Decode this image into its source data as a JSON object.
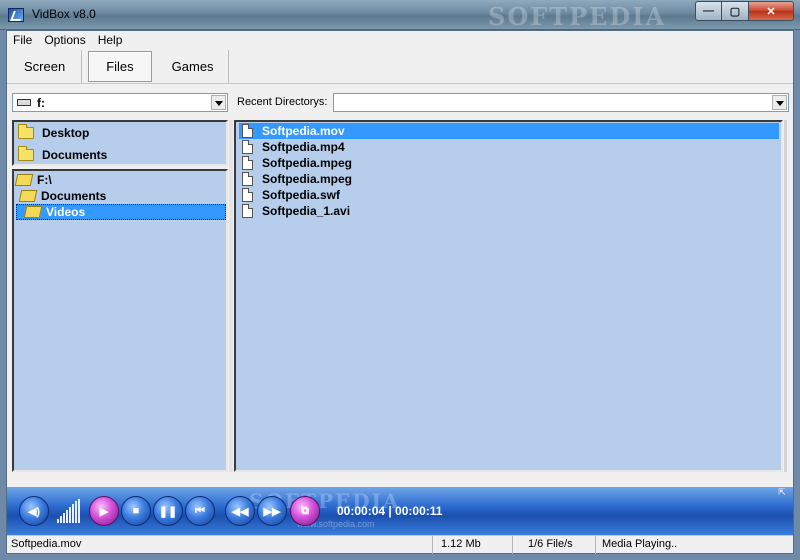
{
  "window": {
    "title": "VidBox v8.0",
    "watermark": "SOFTPEDIA",
    "controls": {
      "minimize": "—",
      "maximize": "▢",
      "close": "✕"
    }
  },
  "menu": [
    "File",
    "Options",
    "Help"
  ],
  "tabs": [
    {
      "label": "Screen",
      "active": false
    },
    {
      "label": "Files",
      "active": true
    },
    {
      "label": "Games",
      "active": false
    }
  ],
  "drive": {
    "selected": "f:"
  },
  "recent": {
    "label": "Recent Directorys:",
    "value": ""
  },
  "favorites": [
    "Desktop",
    "Documents"
  ],
  "tree": [
    {
      "label": "F:\\",
      "depth": 0
    },
    {
      "label": "Documents",
      "depth": 1
    },
    {
      "label": "Videos",
      "depth": 2,
      "selected": true
    }
  ],
  "files": [
    {
      "name": "Softpedia.mov",
      "selected": true
    },
    {
      "name": "Softpedia.mp4"
    },
    {
      "name": "Softpedia.mpeg"
    },
    {
      "name": "Softpedia.mpeg"
    },
    {
      "name": "Softpedia.swf"
    },
    {
      "name": "Softpedia_1.avi"
    }
  ],
  "player": {
    "time": "00:00:04 | 00:00:11",
    "watermark": "SOFTPEDIA",
    "watermark_url": "www.softpedia.com",
    "buttons": [
      {
        "name": "audio-button",
        "glyph": "◀)",
        "pink": false
      },
      {
        "name": "play-button",
        "glyph": "▶",
        "pink": true
      },
      {
        "name": "stop-button",
        "glyph": "■",
        "pink": false
      },
      {
        "name": "pause-button",
        "glyph": "❚❚",
        "pink": false
      },
      {
        "name": "previous-button",
        "glyph": "⏮",
        "pink": false
      },
      {
        "name": "rewind-button",
        "glyph": "◀◀",
        "pink": false
      },
      {
        "name": "forward-button",
        "glyph": "▶▶",
        "pink": false
      },
      {
        "name": "snapshot-button",
        "glyph": "⧉",
        "pink": true
      }
    ],
    "resize": "⇱"
  },
  "status": {
    "file": "Softpedia.mov",
    "size": "1.12 Mb",
    "count": "1/6 File/s",
    "state": "Media Playing.."
  }
}
